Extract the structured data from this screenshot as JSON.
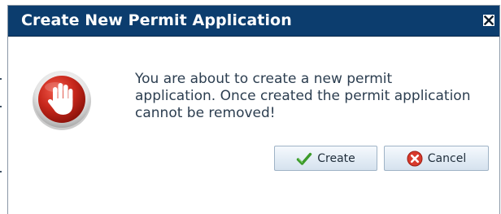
{
  "dialog": {
    "title": "Create New Permit Application",
    "close_icon": "close-icon",
    "message": "You are about to create a new permit application. Once created the permit application cannot be removed!",
    "message_icon": "stop-hand-icon",
    "buttons": {
      "create_label": "Create",
      "create_icon": "checkmark-icon",
      "cancel_label": "Cancel",
      "cancel_icon": "cancel-x-icon"
    }
  },
  "colors": {
    "titlebar": "#0c3d6e",
    "title_text": "#ffffff",
    "message_text": "#2c3e50",
    "stop_icon": "#c0281e",
    "check_icon": "#3c9a2a",
    "cancel_icon": "#d83a2c"
  }
}
